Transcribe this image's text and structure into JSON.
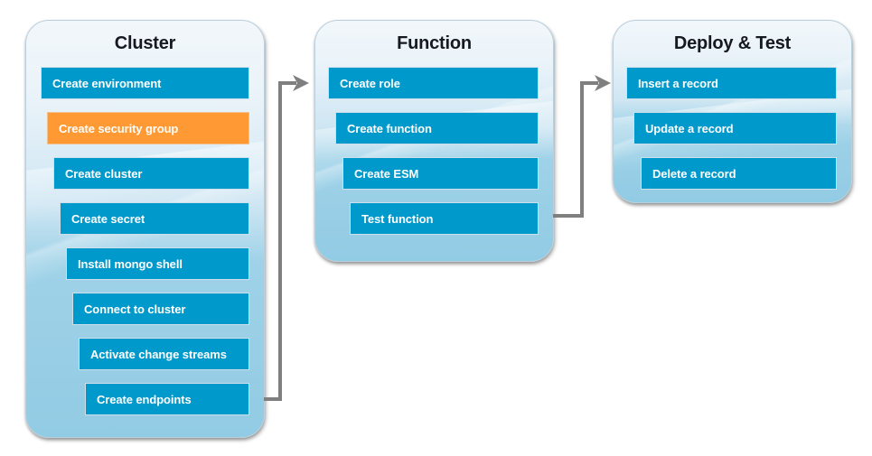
{
  "diagram": {
    "title": "Cluster / Function / Deploy & Test workflow",
    "colors": {
      "step_fill": "#0099cc",
      "step_highlight_fill": "#ff9933",
      "step_text": "#ffffff",
      "container_top": "#f2f7fb",
      "container_bottom": "#92cbe4",
      "connector": "#7f7f7f",
      "title_text": "#16191f"
    },
    "groups": [
      {
        "id": "cluster",
        "title": "Cluster",
        "steps": [
          {
            "label": "Create environment",
            "highlight": false
          },
          {
            "label": "Create security group",
            "highlight": true
          },
          {
            "label": "Create cluster",
            "highlight": false
          },
          {
            "label": "Create secret",
            "highlight": false
          },
          {
            "label": "Install mongo shell",
            "highlight": false
          },
          {
            "label": "Connect to cluster",
            "highlight": false
          },
          {
            "label": "Activate change streams",
            "highlight": false
          },
          {
            "label": "Create endpoints",
            "highlight": false
          }
        ]
      },
      {
        "id": "function",
        "title": "Function",
        "steps": [
          {
            "label": "Create role",
            "highlight": false
          },
          {
            "label": "Create function",
            "highlight": false
          },
          {
            "label": "Create ESM",
            "highlight": false
          },
          {
            "label": "Test function",
            "highlight": false
          }
        ]
      },
      {
        "id": "deploy-test",
        "title": "Deploy & Test",
        "steps": [
          {
            "label": "Insert a record",
            "highlight": false
          },
          {
            "label": "Update a record",
            "highlight": false
          },
          {
            "label": "Delete a record",
            "highlight": false
          }
        ]
      }
    ],
    "connectors": [
      {
        "id": "cluster-to-function",
        "from": "Create endpoints",
        "to": "Create role"
      },
      {
        "id": "function-to-deploytest",
        "from": "Test function",
        "to": "Insert a record"
      }
    ]
  }
}
